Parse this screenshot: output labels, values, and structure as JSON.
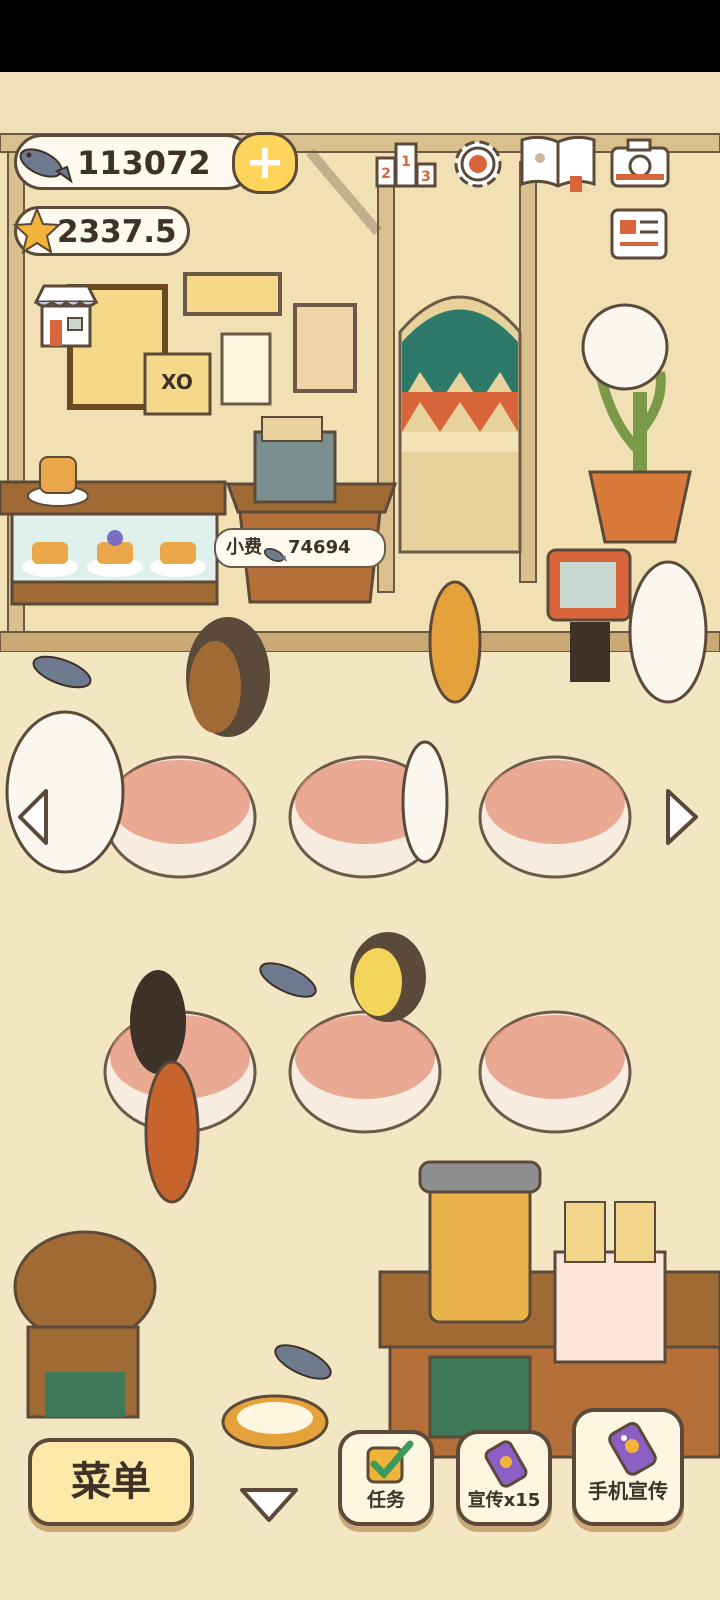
{
  "hud": {
    "fish_count": "113072",
    "star_count": "2337.5",
    "add_symbol": "+"
  },
  "tip_bubble": {
    "label": "小费",
    "amount": "74694"
  },
  "frame_sign": "XO",
  "bottom_bar": {
    "menu_label": "菜单",
    "tasks_label": "任务",
    "promo_label": "宣传x15",
    "phone_promo_label": "手机宣传"
  },
  "colors": {
    "wall": "#f0e0b4",
    "floor": "#f3e6c3",
    "wood": "#a06a35",
    "tablecloth": "#e6937a",
    "accent_yellow": "#ffd45a"
  }
}
